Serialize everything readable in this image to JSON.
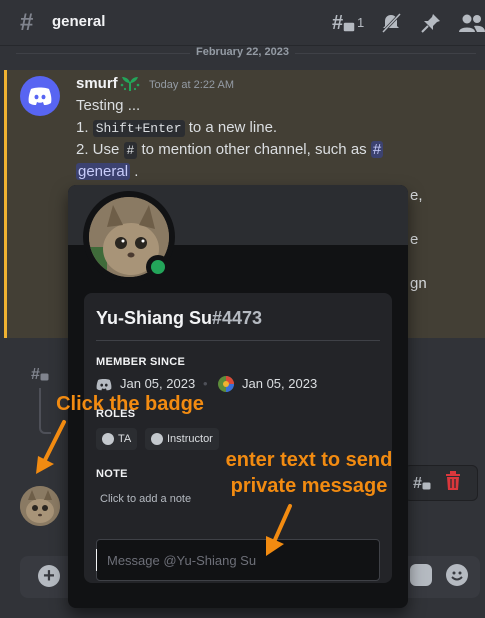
{
  "header": {
    "channel": "general",
    "thread_count": "1"
  },
  "date_divider": "February 22, 2023",
  "message": {
    "author": "smurf",
    "timestamp": "Today at 2:22 AM",
    "line1": "Testing ...",
    "line2_prefix": "1.",
    "line2_code": "Shift+Enter",
    "line2_suffix": "to a new line.",
    "line3_prefix": "2. Use",
    "line3_code": "#",
    "line3_mid": "to mention other channel, such as",
    "line3_mention_hash": "#",
    "line4_mention": "general",
    "line4_suffix": ".",
    "fragment_a": "e,",
    "fragment_b": "e",
    "fragment_c": "gn"
  },
  "profile": {
    "name": "Yu-Shiang Su",
    "discriminator": "#4473",
    "member_since_title": "MEMBER SINCE",
    "discord_date": "Jan 05, 2023",
    "server_date": "Jan 05, 2023",
    "roles_title": "ROLES",
    "roles": [
      "TA",
      "Instructor"
    ],
    "note_title": "NOTE",
    "note_placeholder": "Click to add a note",
    "message_placeholder": "Message @Yu-Shiang Su"
  },
  "annotations": {
    "badge": "Click the badge",
    "private_line1": "enter text to send",
    "private_line2": "private message"
  },
  "colors": {
    "accent": "#f28b11",
    "online": "#23a55a",
    "mention_bg": "#3c4270",
    "blurple": "#5865f2"
  }
}
